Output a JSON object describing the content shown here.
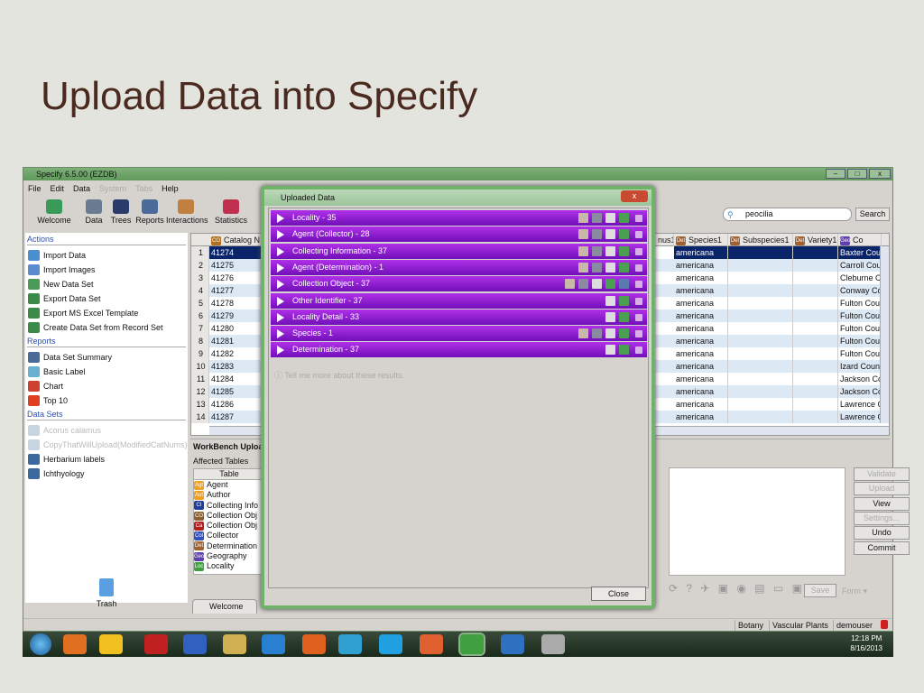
{
  "slide_title": "Upload Data into Specify",
  "window": {
    "title": "Specify 6.5.00 (EZDB)"
  },
  "menu": [
    {
      "label": "File",
      "enabled": true
    },
    {
      "label": "Edit",
      "enabled": true
    },
    {
      "label": "Data",
      "enabled": true
    },
    {
      "label": "System",
      "enabled": false
    },
    {
      "label": "Tabs",
      "enabled": false
    },
    {
      "label": "Help",
      "enabled": true
    }
  ],
  "toolbar": [
    {
      "label": "Welcome",
      "icon": "specify-logo-icon"
    },
    {
      "label": "Data",
      "icon": "data-icon"
    },
    {
      "label": "Trees",
      "icon": "trees-icon"
    },
    {
      "label": "Reports",
      "icon": "reports-icon"
    },
    {
      "label": "Interactions",
      "icon": "interactions-icon"
    },
    {
      "label": "Statistics",
      "icon": "statistics-icon"
    },
    {
      "label": "Q",
      "icon": "query-icon"
    }
  ],
  "search": {
    "value": "peocilia",
    "button": "Search"
  },
  "sidebar": {
    "actions_header": "Actions",
    "actions": [
      "Import Data",
      "Import Images",
      "New Data Set",
      "Export Data Set",
      "Export MS Excel Template",
      "Create Data Set from Record Set"
    ],
    "reports_header": "Reports",
    "reports": [
      "Data Set Summary",
      "Basic Label",
      "Chart",
      "Top 10"
    ],
    "datasets_header": "Data Sets",
    "datasets": [
      {
        "label": "Acorus calamus",
        "enabled": false
      },
      {
        "label": "CopyThatWillUpload(ModifiedCatNums)",
        "enabled": false
      },
      {
        "label": "Herbarium labels",
        "enabled": true
      },
      {
        "label": "Ichthyology",
        "enabled": true
      }
    ],
    "trash": "Trash"
  },
  "grid": {
    "headers": {
      "catalog": "Catalog N",
      "genus": "nus1",
      "species": "Species1",
      "subspecies": "Subspecies1",
      "variety": "Variety1",
      "county": "Co"
    },
    "rows": [
      {
        "n": "1",
        "catalog": "41274",
        "species": "americana",
        "county": "Baxter Cour"
      },
      {
        "n": "2",
        "catalog": "41275",
        "species": "americana",
        "county": "Carroll Cou"
      },
      {
        "n": "3",
        "catalog": "41276",
        "species": "americana",
        "county": "Cleburne C"
      },
      {
        "n": "4",
        "catalog": "41277",
        "species": "americana",
        "county": "Conway Co"
      },
      {
        "n": "5",
        "catalog": "41278",
        "species": "americana",
        "county": "Fulton Cour"
      },
      {
        "n": "6",
        "catalog": "41279",
        "species": "americana",
        "county": "Fulton Cour"
      },
      {
        "n": "7",
        "catalog": "41280",
        "species": "americana",
        "county": "Fulton Cour"
      },
      {
        "n": "8",
        "catalog": "41281",
        "species": "americana",
        "county": "Fulton Cour"
      },
      {
        "n": "9",
        "catalog": "41282",
        "species": "americana",
        "county": "Fulton Cour"
      },
      {
        "n": "10",
        "catalog": "41283",
        "species": "americana",
        "county": "Izard Count"
      },
      {
        "n": "11",
        "catalog": "41284",
        "species": "americana",
        "county": "Jackson Co"
      },
      {
        "n": "12",
        "catalog": "41285",
        "species": "americana",
        "county": "Jackson Co"
      },
      {
        "n": "13",
        "catalog": "41286",
        "species": "americana",
        "county": "Lawrence C"
      },
      {
        "n": "14",
        "catalog": "41287",
        "species": "americana",
        "county": "Lawrence C"
      }
    ]
  },
  "workbench": {
    "title": "WorkBench Upload",
    "affected_label": "Affected Tables",
    "table_header": "Table",
    "tables": [
      {
        "abbr": "Agt",
        "name": "Agent",
        "color": "#f0a020"
      },
      {
        "abbr": "Aut",
        "name": "Author",
        "color": "#f0a020"
      },
      {
        "abbr": "CI",
        "name": "Collecting Info",
        "color": "#2040a0"
      },
      {
        "abbr": "CO",
        "name": "Collection Obj",
        "color": "#8a6030"
      },
      {
        "abbr": "Ca",
        "name": "Collection Obj",
        "color": "#b02020"
      },
      {
        "abbr": "Col",
        "name": "Collector",
        "color": "#3050c0"
      },
      {
        "abbr": "Det",
        "name": "Determination",
        "color": "#a06030"
      },
      {
        "abbr": "Geo",
        "name": "Geography",
        "color": "#6040b0"
      },
      {
        "abbr": "Loc",
        "name": "Locality",
        "color": "#40a040"
      }
    ],
    "buttons": [
      {
        "label": "Validate",
        "enabled": false
      },
      {
        "label": "Upload",
        "enabled": false
      },
      {
        "label": "View",
        "enabled": true
      },
      {
        "label": "Settings...",
        "enabled": false
      },
      {
        "label": "Undo",
        "enabled": true
      },
      {
        "label": "Commit",
        "enabled": true
      }
    ],
    "save": "Save",
    "form": "Form"
  },
  "tabs": [
    {
      "label": "Welcome"
    }
  ],
  "status": [
    "Botany",
    "Vascular Plants",
    "demouser"
  ],
  "taskbar": {
    "time": "12:18 PM",
    "date": "8/16/2013"
  },
  "dialog": {
    "title": "Uploaded Data",
    "items": [
      {
        "label": "Locality - 35",
        "icons": 5
      },
      {
        "label": "Agent (Collector) - 28",
        "icons": 5
      },
      {
        "label": "Collecting Information - 37",
        "icons": 5
      },
      {
        "label": "Agent (Determination) - 1",
        "icons": 5
      },
      {
        "label": "Collection Object - 37",
        "icons": 6
      },
      {
        "label": "Other Identifier - 37",
        "icons": 3
      },
      {
        "label": "Locality Detail - 33",
        "icons": 3
      },
      {
        "label": "Species - 1",
        "icons": 5
      },
      {
        "label": "Determination - 37",
        "icons": 3
      }
    ],
    "help": "Tell me more about these results.",
    "close": "Close",
    "accent": "#9020d0"
  }
}
